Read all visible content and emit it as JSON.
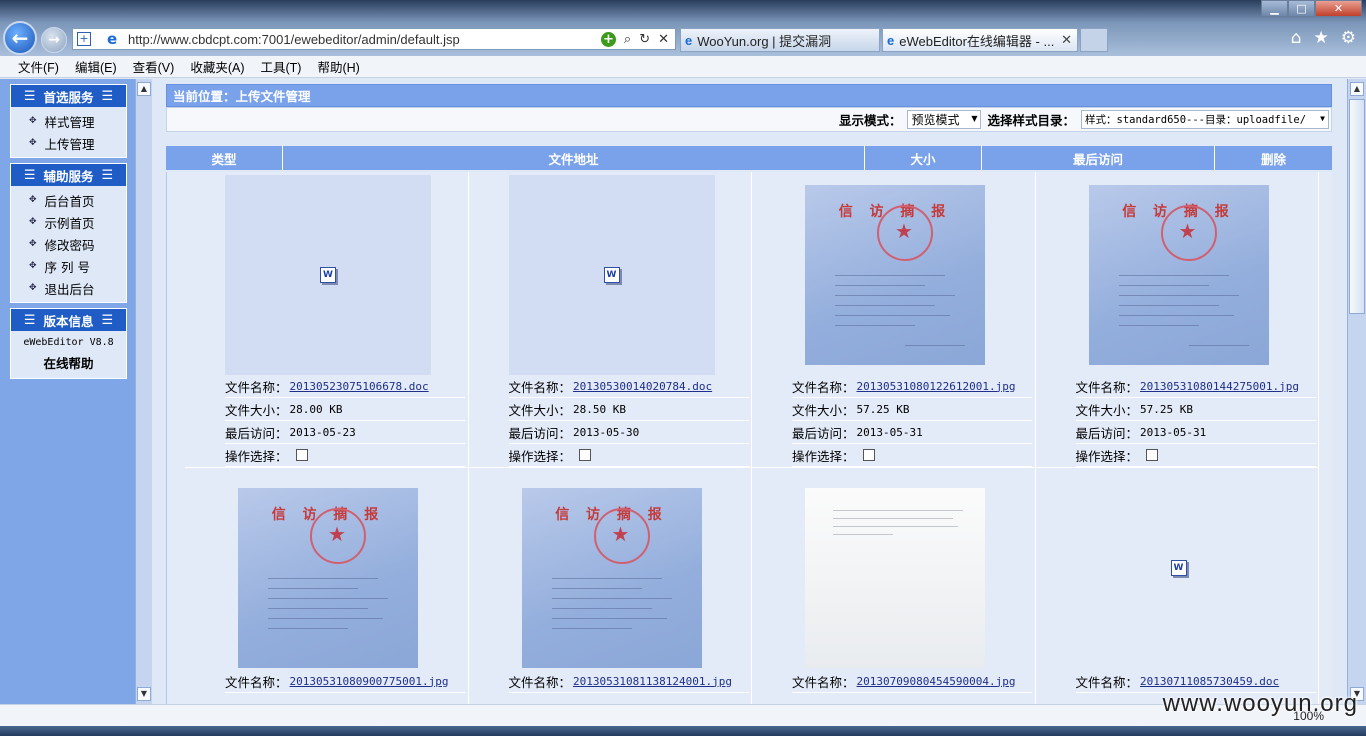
{
  "browser": {
    "url": "http://www.cbdcpt.com:7001/ewebeditor/admin/default.jsp",
    "tabs": [
      {
        "label": "WooYun.org | 提交漏洞"
      },
      {
        "label": "eWebEditor在线编辑器 - ..."
      }
    ],
    "menu": [
      "文件(F)",
      "编辑(E)",
      "查看(V)",
      "收藏夹(A)",
      "工具(T)",
      "帮助(H)"
    ],
    "zoom": "100%"
  },
  "sidebar": {
    "sections": [
      {
        "title": "首选服务",
        "items": [
          "样式管理",
          "上传管理"
        ]
      },
      {
        "title": "辅助服务",
        "items": [
          "后台首页",
          "示例首页",
          "修改密码",
          "序 列 号",
          "退出后台"
        ]
      },
      {
        "title": "版本信息",
        "version": "eWebEditor V8.8",
        "help": "在线帮助"
      }
    ]
  },
  "main": {
    "location": "当前位置：上传文件管理",
    "display_mode_label": "显示模式：",
    "display_mode_value": "预览模式",
    "style_dir_label": "选择样式目录：",
    "style_dir_value": "样式：standard650---目录：uploadfile/",
    "columns": [
      "类型",
      "文件地址",
      "大小",
      "最后访问",
      "删除"
    ],
    "field_labels": {
      "name": "文件名称：",
      "size": "文件大小：",
      "access": "最后访问：",
      "op": "操作选择："
    },
    "files": [
      {
        "name": "20130523075106678.doc",
        "size": "28.00 KB",
        "access": "2013-05-23",
        "kind": "doc"
      },
      {
        "name": "20130530014020784.doc",
        "size": "28.50 KB",
        "access": "2013-05-30",
        "kind": "doc"
      },
      {
        "name": "20130531080122612001.jpg",
        "size": "57.25 KB",
        "access": "2013-05-31",
        "kind": "photo"
      },
      {
        "name": "20130531080144275001.jpg",
        "size": "57.25 KB",
        "access": "2013-05-31",
        "kind": "photo"
      },
      {
        "name": "20130531080900775001.jpg",
        "kind": "photo"
      },
      {
        "name": "20130531081138124001.jpg",
        "kind": "photo"
      },
      {
        "name": "20130709080454590004.jpg",
        "kind": "white"
      },
      {
        "name": "20130711085730459.doc",
        "kind": "doc"
      }
    ],
    "photo_title": "信 访 摘 报",
    "doc_icon": "word-doc-icon"
  },
  "watermark": "www.wooyun.org"
}
